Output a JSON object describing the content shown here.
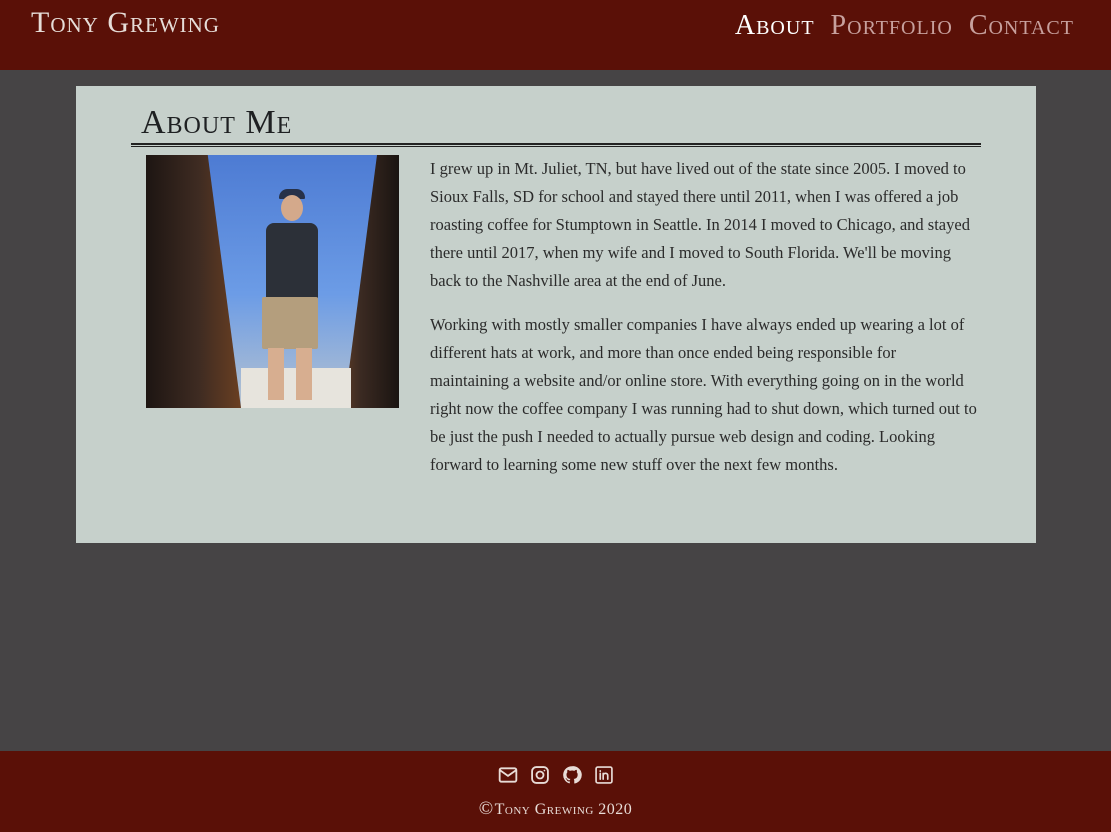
{
  "header": {
    "brand": "Tony Grewing",
    "nav": [
      {
        "label": "About",
        "active": true
      },
      {
        "label": "Portfolio",
        "active": false
      },
      {
        "label": "Contact",
        "active": false
      }
    ]
  },
  "about": {
    "title": "About Me",
    "paragraphs": [
      "I grew up in Mt. Juliet, TN, but have lived out of the state since 2005. I moved to Sioux Falls, SD for school and stayed there until 2011, when I was offered a job roasting coffee for Stumptown in Seattle. In 2014 I moved to Chicago, and stayed there until 2017, when my wife and I moved to South Florida. We'll be moving back to the Nashville area at the end of June.",
      "Working with mostly smaller companies I have always ended up wearing a lot of different hats at work, and more than once ended being responsible for maintaining a website and/or online store. With everything going on in the world right now the coffee company I was running had to shut down, which turned out to be just the push I needed to actually pursue web design and coding. Looking forward to learning some new stuff over the next few months."
    ]
  },
  "footer": {
    "icons": [
      "envelope-icon",
      "instagram-icon",
      "github-icon",
      "linkedin-icon"
    ],
    "copyright_symbol": "©",
    "copyright_text": "Tony Grewing 2020"
  },
  "colors": {
    "header_bg": "#5a1007",
    "page_bg": "#464445",
    "card_bg": "#c6d0cb",
    "nav_active": "#ffffff",
    "nav_inactive": "#c7a09d"
  }
}
